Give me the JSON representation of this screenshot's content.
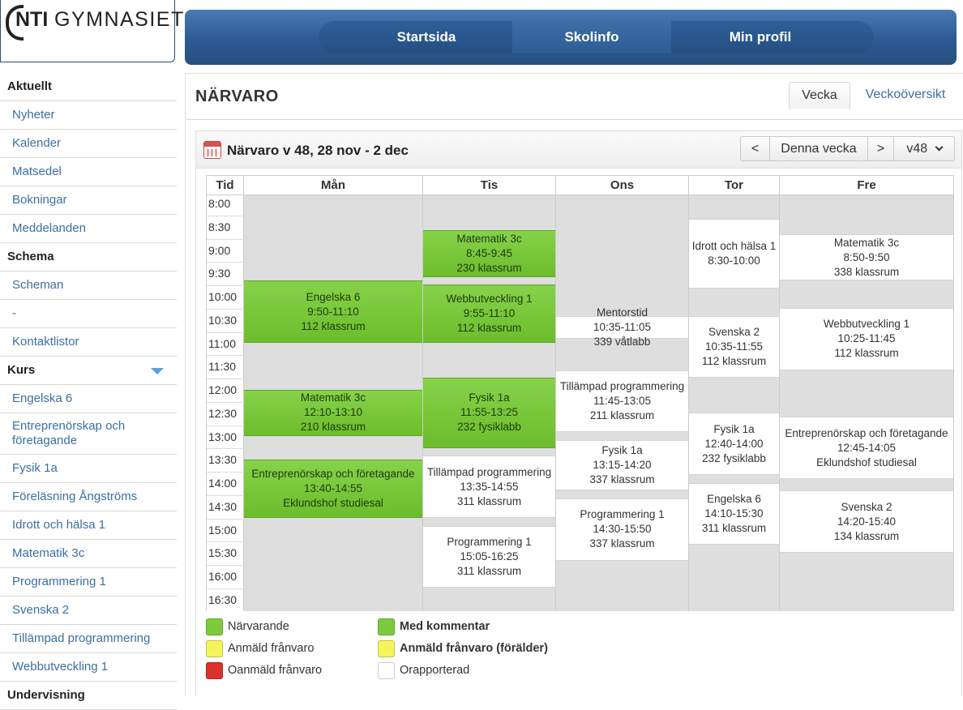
{
  "logo": {
    "nti": "NTI",
    "gym": "GYMNASIET"
  },
  "topnav": {
    "items": [
      "Startsida",
      "Skolinfo",
      "Min profil"
    ],
    "active_index": 1
  },
  "sidebar": {
    "items": [
      {
        "label": "Aktuellt",
        "type": "head"
      },
      {
        "label": "Nyheter",
        "type": "link"
      },
      {
        "label": "Kalender",
        "type": "link"
      },
      {
        "label": "Matsedel",
        "type": "link"
      },
      {
        "label": "Bokningar",
        "type": "link"
      },
      {
        "label": "Meddelanden",
        "type": "link"
      },
      {
        "label": "Schema",
        "type": "head"
      },
      {
        "label": "Scheman",
        "type": "link"
      },
      {
        "label": "-",
        "type": "link"
      },
      {
        "label": "Kontaktlistor",
        "type": "link"
      },
      {
        "label": "Kurs",
        "type": "head"
      },
      {
        "label": "Engelska 6",
        "type": "link"
      },
      {
        "label": "Entreprenörskap och\nföretagande",
        "type": "link"
      },
      {
        "label": "Fysik 1a",
        "type": "link"
      },
      {
        "label": "Föreläsning Ångströms",
        "type": "link"
      },
      {
        "label": "Idrott och hälsa 1",
        "type": "link"
      },
      {
        "label": "Matematik 3c",
        "type": "link"
      },
      {
        "label": "Programmering 1",
        "type": "link"
      },
      {
        "label": "Svenska 2",
        "type": "link"
      },
      {
        "label": "Tillämpad programmering",
        "type": "link"
      },
      {
        "label": "Webbutveckling 1",
        "type": "link"
      },
      {
        "label": "Undervisning",
        "type": "head"
      }
    ]
  },
  "page": {
    "title": "NÄRVARO",
    "tabs": [
      "Vecka",
      "Veckoöversikt"
    ],
    "active_tab": 0
  },
  "panel": {
    "title": "Närvaro v 48, 28 nov - 2 dec",
    "nav": {
      "prev": "<",
      "current": "Denna vecka",
      "next": ">",
      "week": "v48"
    }
  },
  "schedule": {
    "time_header": "Tid",
    "times": [
      "8:00",
      "8:30",
      "9:00",
      "9:30",
      "10:00",
      "10:30",
      "11:00",
      "11:30",
      "12:00",
      "12:30",
      "13:00",
      "13:30",
      "14:00",
      "14:30",
      "15:00",
      "15:30",
      "16:00",
      "16:30"
    ],
    "days": [
      {
        "name": "Mån",
        "events": [
          {
            "start": "9:50",
            "end": "11:10",
            "course": "Engelska 6",
            "time": "9:50-11:10",
            "room": "112 klassrum",
            "status": "green"
          },
          {
            "start": "12:10",
            "end": "13:10",
            "course": "Matematik 3c",
            "time": "12:10-13:10",
            "room": "210 klassrum",
            "status": "green"
          },
          {
            "start": "13:40",
            "end": "14:55",
            "course": "Entreprenörskap och företagande",
            "time": "13:40-14:55",
            "room": "Eklundshof studiesal",
            "status": "green"
          }
        ]
      },
      {
        "name": "Tis",
        "events": [
          {
            "start": "8:45",
            "end": "9:45",
            "course": "Matematik 3c",
            "time": "8:45-9:45",
            "room": "230 klassrum",
            "status": "green"
          },
          {
            "start": "9:55",
            "end": "11:10",
            "course": "Webbutveckling 1",
            "time": "9:55-11:10",
            "room": "112 klassrum",
            "status": "green"
          },
          {
            "start": "11:55",
            "end": "13:25",
            "course": "Fysik 1a",
            "time": "11:55-13:25",
            "room": "232 fysiklabb",
            "status": "green"
          },
          {
            "start": "13:35",
            "end": "14:55",
            "course": "Tillämpad programmering",
            "time": "13:35-14:55",
            "room": "311 klassrum",
            "status": "white"
          },
          {
            "start": "15:05",
            "end": "16:25",
            "course": "Programmering 1",
            "time": "15:05-16:25",
            "room": "311 klassrum",
            "status": "white"
          }
        ]
      },
      {
        "name": "Ons",
        "events": [
          {
            "start": "10:35",
            "end": "11:05",
            "course": "Mentorstid",
            "time": "10:35-11:05",
            "room": "339 våtlabb",
            "status": "white"
          },
          {
            "start": "11:45",
            "end": "13:05",
            "course": "Tillämpad programmering",
            "time": "11:45-13:05",
            "room": "211 klassrum",
            "status": "white"
          },
          {
            "start": "13:15",
            "end": "14:20",
            "course": "Fysik 1a",
            "time": "13:15-14:20",
            "room": "337 klassrum",
            "status": "white"
          },
          {
            "start": "14:30",
            "end": "15:50",
            "course": "Programmering 1",
            "time": "14:30-15:50",
            "room": "337 klassrum",
            "status": "white"
          }
        ]
      },
      {
        "name": "Tor",
        "events": [
          {
            "start": "8:30",
            "end": "10:00",
            "course": "Idrott och hälsa 1",
            "time": "8:30-10:00",
            "room": "",
            "status": "white"
          },
          {
            "start": "10:35",
            "end": "11:55",
            "course": "Svenska 2",
            "time": "10:35-11:55",
            "room": "112 klassrum",
            "status": "white"
          },
          {
            "start": "12:40",
            "end": "14:00",
            "course": "Fysik 1a",
            "time": "12:40-14:00",
            "room": "232 fysiklabb",
            "status": "white"
          },
          {
            "start": "14:10",
            "end": "15:30",
            "course": "Engelska 6",
            "time": "14:10-15:30",
            "room": "311 klassrum",
            "status": "white"
          }
        ]
      },
      {
        "name": "Fre",
        "events": [
          {
            "start": "8:50",
            "end": "9:50",
            "course": "Matematik 3c",
            "time": "8:50-9:50",
            "room": "338 klassrum",
            "status": "white"
          },
          {
            "start": "10:25",
            "end": "11:45",
            "course": "Webbutveckling 1",
            "time": "10:25-11:45",
            "room": "112 klassrum",
            "status": "white"
          },
          {
            "start": "12:45",
            "end": "14:05",
            "course": "Entreprenörskap och företagande",
            "time": "12:45-14:05",
            "room": "Eklundshof studiesal",
            "status": "white"
          },
          {
            "start": "14:20",
            "end": "15:40",
            "course": "Svenska 2",
            "time": "14:20-15:40",
            "room": "134 klassrum",
            "status": "white"
          }
        ]
      }
    ]
  },
  "legend": [
    {
      "label": "Närvarande",
      "color": "#7ccb3c",
      "bold": false
    },
    {
      "label": "Med kommentar",
      "color": "#7ccb3c",
      "bold": true
    },
    {
      "label": "Anmäld frånvaro",
      "color": "#f7f35a",
      "bold": false
    },
    {
      "label": "Anmäld frånvaro (förälder)",
      "color": "#f7f35a",
      "bold": true
    },
    {
      "label": "Oanmäld frånvaro",
      "color": "#d9312b",
      "bold": false
    },
    {
      "label": "Orapporterad",
      "color": "#ffffff",
      "bold": false
    }
  ]
}
